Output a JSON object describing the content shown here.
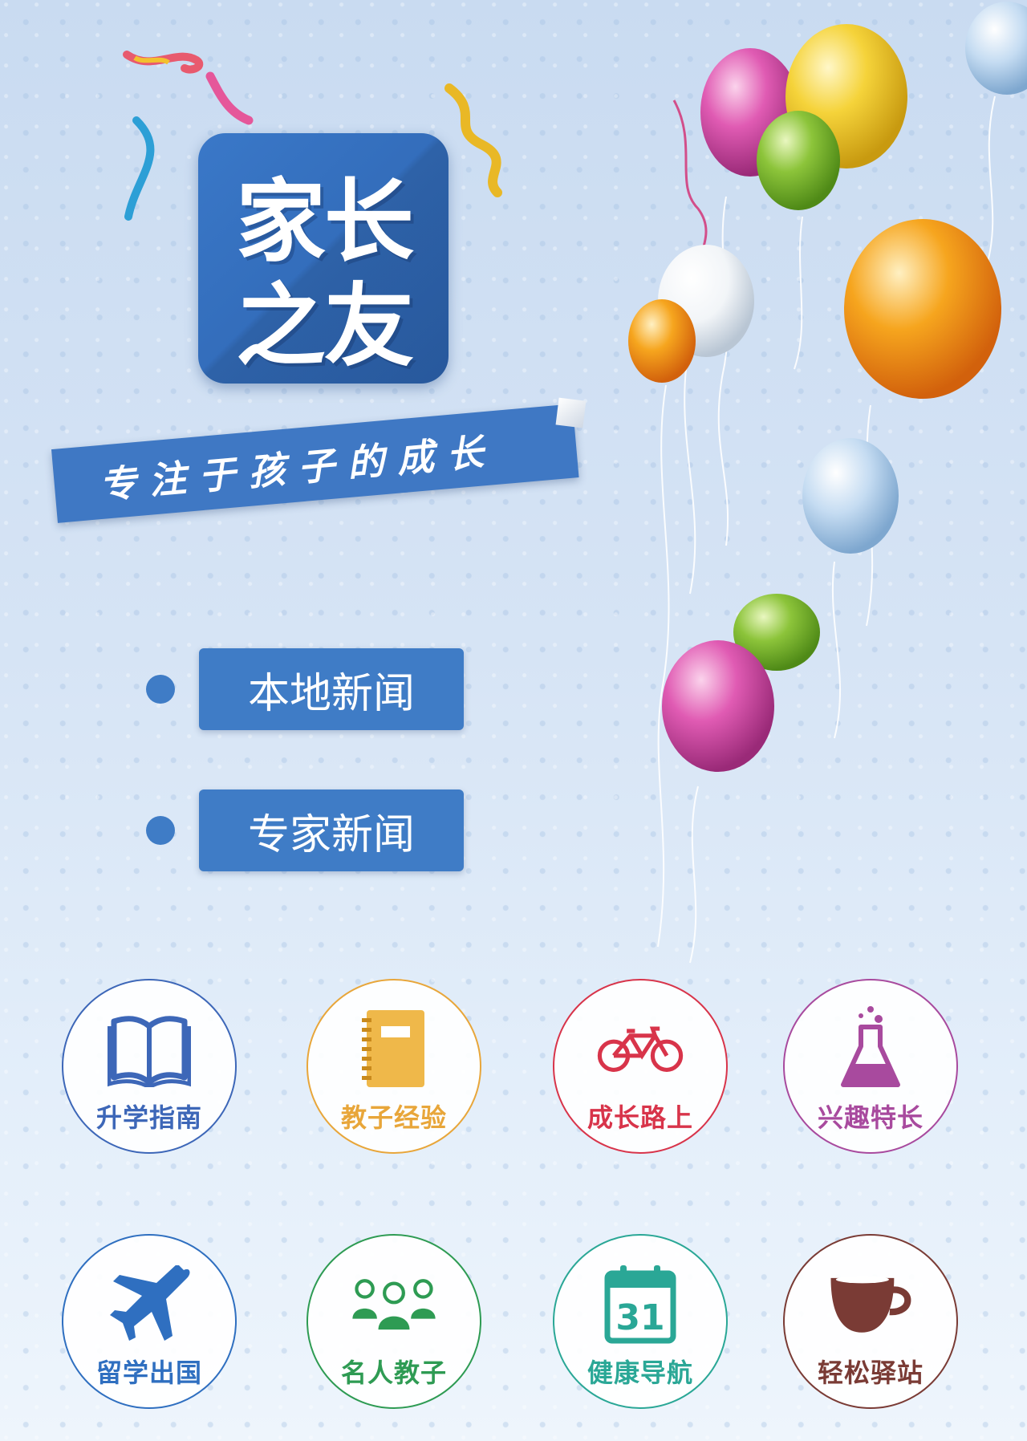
{
  "logo": {
    "line1": "家长",
    "line2": "之友"
  },
  "slogan": "专注于孩子的成长",
  "news": [
    {
      "label": "本地新闻"
    },
    {
      "label": "专家新闻"
    }
  ],
  "categories": [
    {
      "label": "升学指南",
      "icon": "open-book-icon",
      "color": "#3d67b8"
    },
    {
      "label": "教子经验",
      "icon": "notebook-icon",
      "color": "#e8a63a"
    },
    {
      "label": "成长路上",
      "icon": "bicycle-icon",
      "color": "#d8344a"
    },
    {
      "label": "兴趣特长",
      "icon": "flask-icon",
      "color": "#a84a9e"
    },
    {
      "label": "留学出国",
      "icon": "airplane-icon",
      "color": "#2f6fc0"
    },
    {
      "label": "名人教子",
      "icon": "people-group-icon",
      "color": "#2e9b53"
    },
    {
      "label": "健康导航",
      "icon": "calendar-icon",
      "color": "#2aa796",
      "calendar_number": "31"
    },
    {
      "label": "轻松驿站",
      "icon": "coffee-cup-icon",
      "color": "#7a3b35"
    }
  ],
  "colors": {
    "primary": "#3f7cc6",
    "background": "#d6e4f5"
  }
}
